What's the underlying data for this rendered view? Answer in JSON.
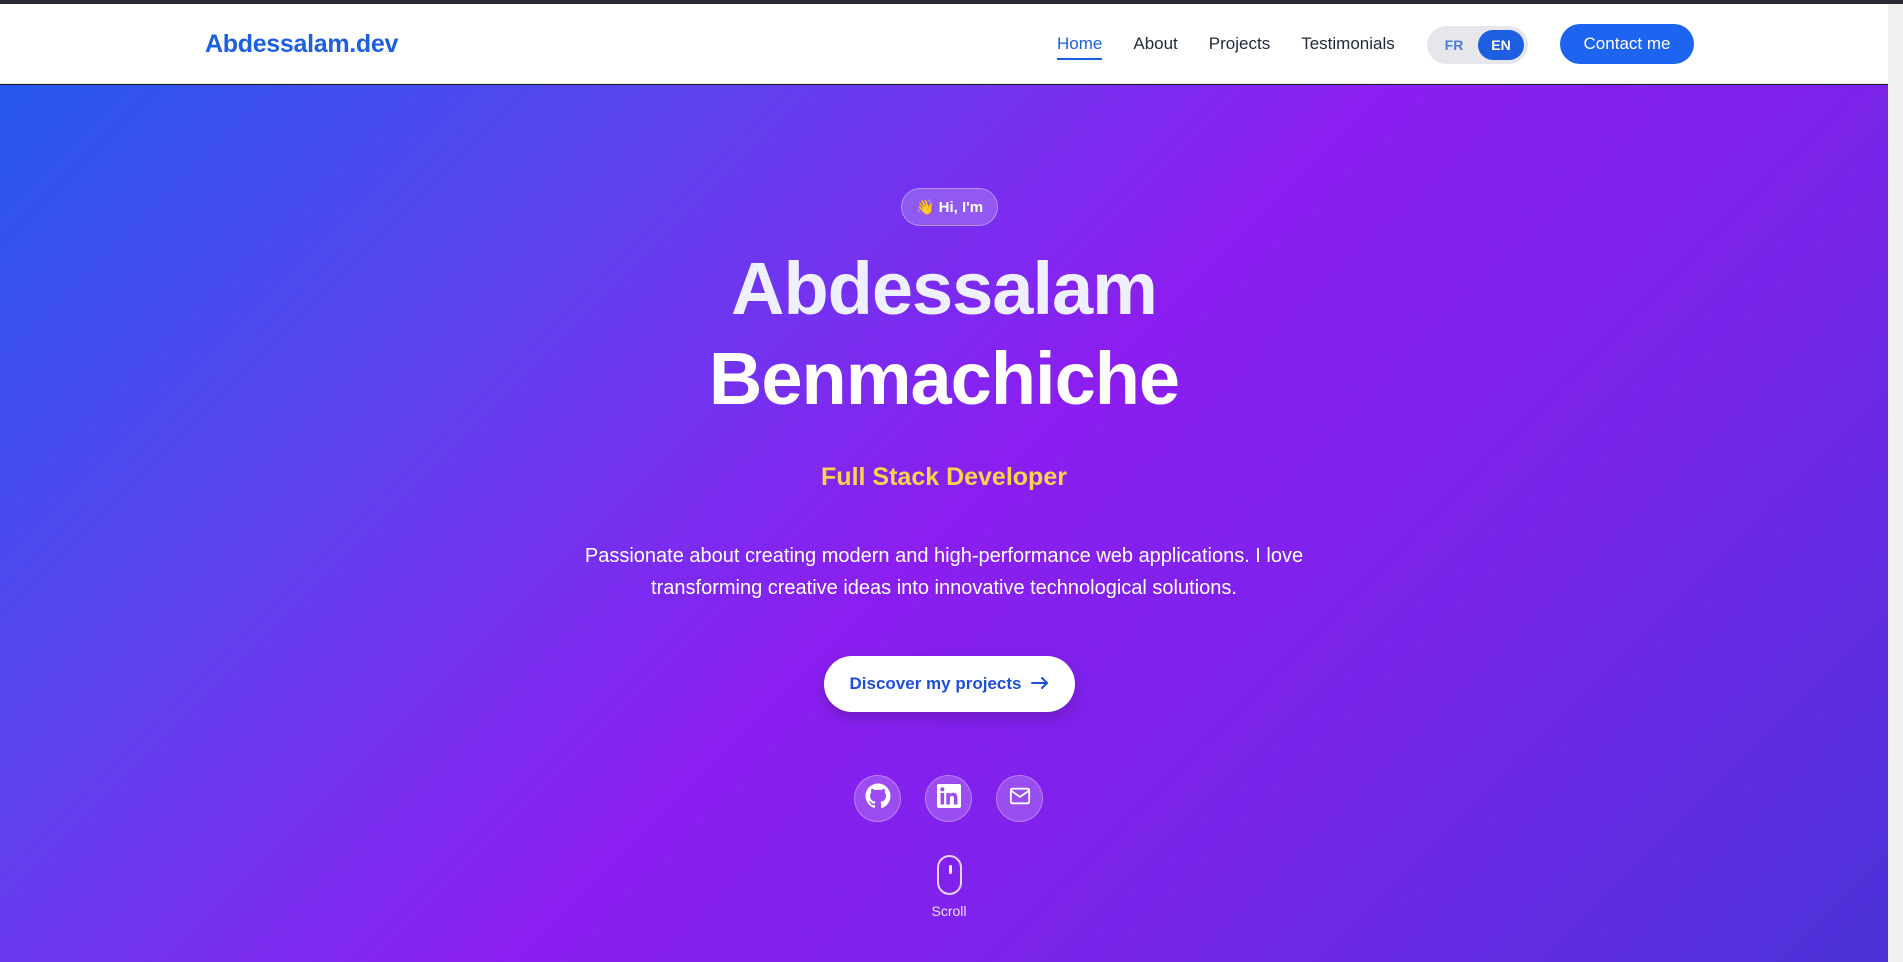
{
  "nav": {
    "brand": "Abdessalam.dev",
    "links": [
      {
        "label": "Home",
        "active": true
      },
      {
        "label": "About",
        "active": false
      },
      {
        "label": "Projects",
        "active": false
      },
      {
        "label": "Testimonials",
        "active": false
      }
    ],
    "languages": [
      {
        "label": "FR",
        "selected": false
      },
      {
        "label": "EN",
        "selected": true
      }
    ],
    "contact_label": "Contact me"
  },
  "hero": {
    "greeting_emoji": "👋",
    "greeting": "Hi, I'm",
    "first_name": "Abdessalam",
    "last_name": "Benmachiche",
    "role": "Full Stack Developer",
    "description": "Passionate about creating modern and high-performance web applications. I love transforming creative ideas into innovative technological solutions.",
    "cta_label": "Discover my projects",
    "cta_icon": "arrow-right-icon",
    "socials": [
      {
        "name": "github-icon"
      },
      {
        "name": "linkedin-icon"
      },
      {
        "name": "mail-icon"
      }
    ],
    "scroll_label": "Scroll"
  },
  "colors": {
    "brand_blue": "#1d5fe0",
    "role_yellow": "#fcd34d",
    "gradient_start": "#2657ee",
    "gradient_mid": "#8b1ef0",
    "gradient_end": "#4b32d8"
  }
}
